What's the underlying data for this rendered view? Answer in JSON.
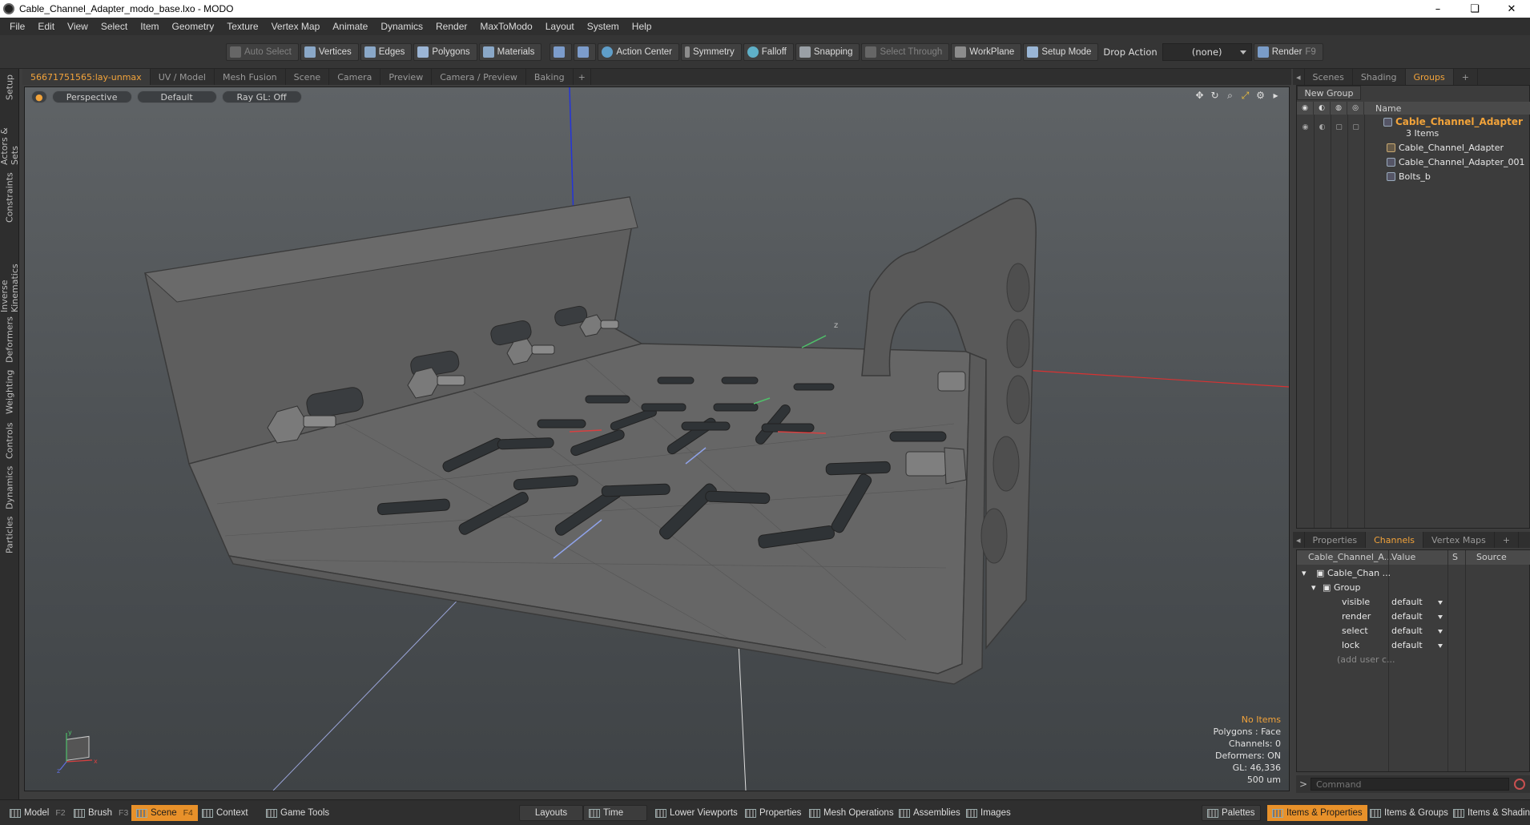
{
  "window": {
    "title": "Cable_Channel_Adapter_modo_base.lxo - MODO",
    "controls": [
      "–",
      "❏",
      "✕"
    ]
  },
  "menubar": [
    "File",
    "Edit",
    "View",
    "Select",
    "Item",
    "Geometry",
    "Texture",
    "Vertex Map",
    "Animate",
    "Dynamics",
    "Render",
    "MaxToModo",
    "Layout",
    "System",
    "Help"
  ],
  "toolbar": {
    "auto_select": "Auto Select",
    "vertices": "Vertices",
    "edges": "Edges",
    "polygons": "Polygons",
    "materials": "Materials",
    "action_center": "Action Center",
    "symmetry": "Symmetry",
    "falloff": "Falloff",
    "snapping": "Snapping",
    "select_through": "Select Through",
    "workplane": "WorkPlane",
    "setup_mode": "Setup Mode",
    "drop_action": "Drop Action",
    "drop_value": "(none)",
    "render": "Render",
    "render_key": "F9"
  },
  "left_tabs": [
    "Setup",
    "Actors & Sets",
    "Constraints",
    "Inverse Kinematics",
    "Deformers",
    "Weighting",
    "Controls",
    "Dynamics",
    "Particles"
  ],
  "viewport_tabs": [
    "56671751565:lay-unmax",
    "UV / Model",
    "Mesh Fusion",
    "Scene",
    "Camera",
    "Preview",
    "Camera / Preview",
    "Baking",
    "+"
  ],
  "viewport": {
    "view": "Perspective",
    "shading": "Default",
    "raygl": "Ray GL: Off",
    "info": {
      "selection": "No Items",
      "polygons": "Polygons : Face",
      "channels": "Channels: 0",
      "deformers": "Deformers: ON",
      "gl": "GL: 46,336",
      "unit": "500 um"
    },
    "gizmo_labels": {
      "y": "y",
      "z": "z",
      "x": "x"
    }
  },
  "right_tabs": [
    "Scenes",
    "Shading",
    "Groups",
    "+"
  ],
  "groups": {
    "new_group": "New Group",
    "name_col": "Name",
    "main": "Cable_Channel_Adapter",
    "count": "3 Items",
    "children": [
      "Cable_Channel_Adapter",
      "Cable_Channel_Adapter_001",
      "Bolts_b"
    ]
  },
  "props_tabs": [
    "Properties",
    "Channels",
    "Vertex Maps",
    "+"
  ],
  "channels": {
    "header": {
      "name": "Cable_Channel_A...",
      "value": "Value",
      "s": "S",
      "source": "Source"
    },
    "item": "Cable_Chan ...",
    "group": "Group",
    "rows": [
      {
        "name": "visible",
        "value": "default"
      },
      {
        "name": "render",
        "value": "default"
      },
      {
        "name": "select",
        "value": "default"
      },
      {
        "name": "lock",
        "value": "default"
      }
    ],
    "add_user": "(add user c..."
  },
  "command": {
    "placeholder": "Command"
  },
  "bottombar": {
    "model": "Model",
    "model_key": "F2",
    "brush": "Brush",
    "brush_key": "F3",
    "scene": "Scene",
    "scene_key": "F4",
    "context": "Context",
    "game_tools": "Game Tools",
    "layouts": "Layouts",
    "time": "Time",
    "lower_viewports": "Lower Viewports",
    "properties": "Properties",
    "mesh_operations": "Mesh Operations",
    "assemblies": "Assemblies",
    "images": "Images",
    "palettes": "Palettes",
    "items_properties": "Items & Properties",
    "items_groups": "Items & Groups",
    "items_shading": "Items & Shading"
  },
  "colors": {
    "accent": "#f2a33a",
    "active_tab": "#e8912a"
  }
}
